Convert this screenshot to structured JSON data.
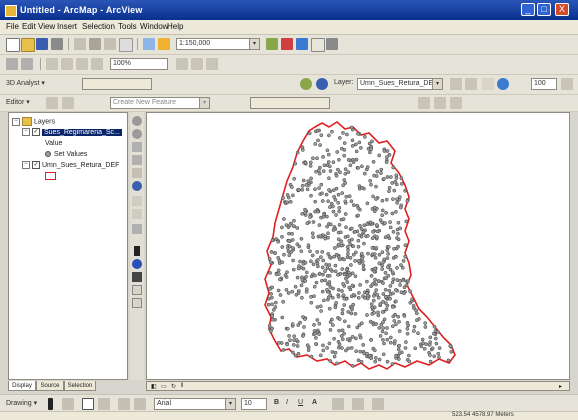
{
  "window": {
    "title": "Untitled - ArcMap - ArcView",
    "minimize": "_",
    "maximize": "□",
    "close": "X"
  },
  "menu": [
    "File",
    "Edit",
    "View",
    "Insert",
    "Selection",
    "Tools",
    "Window",
    "Help"
  ],
  "toolbar1": {
    "scale_value": "1:150,000",
    "dropdown_arrow": "▾"
  },
  "toolbar2": {
    "zoom_value": "100%"
  },
  "toolbar3": {
    "spatial_analyst_label": "3D Analyst ▾",
    "layer_label": "Layer:",
    "layer_value": "Umn_Sues_Retura_DEF",
    "zoom_percent": "100"
  },
  "toolbar4": {
    "editor_label": "Editor ▾",
    "task_value": "Create New Feature",
    "target_label": ""
  },
  "toc": {
    "root": "Layers",
    "layer1": "Sues_Regimarena_Sc...",
    "layer1_value": "Value",
    "layer1_legend": "Set Values",
    "layer2": "Umn_Sues_Retura_DEF"
  },
  "toc_tabs": [
    "Display",
    "Source",
    "Selection"
  ],
  "drawing": {
    "drawing_label": "Drawing ▾",
    "font_name": "Arial",
    "font_size": "10",
    "bold": "B",
    "italic": "I",
    "underline": "U",
    "font_color": "A"
  },
  "status": {
    "coordinates": "523.54  4578.97 Meters"
  },
  "colors": {
    "boundary": "#e02020",
    "points_fill": "#9c9c9c",
    "points_stroke": "#3c3c3c"
  }
}
